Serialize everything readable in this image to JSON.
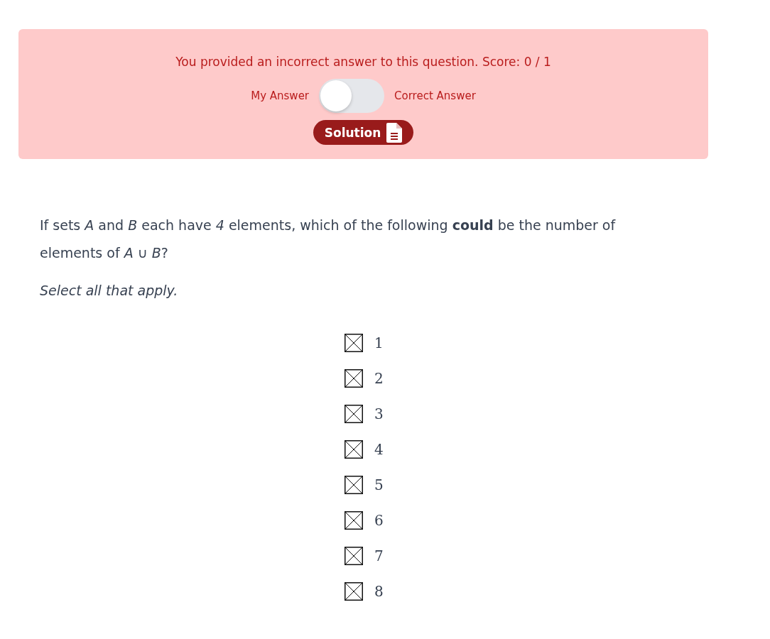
{
  "feedback": {
    "message": "You provided an incorrect answer to this question. Score: 0 / 1",
    "toggle_left": "My Answer",
    "toggle_right": "Correct Answer",
    "toggle": {
      "on": false
    },
    "solution_button": "Solution"
  },
  "question": {
    "text": "If sets *A* and *B* each have *4* elements, which of the following **could** be the number of elements of *A* ∪ *B*?",
    "instruction": "Select all that apply."
  },
  "options": [
    {
      "label": "1"
    },
    {
      "label": "2"
    },
    {
      "label": "3"
    },
    {
      "label": "4"
    },
    {
      "label": "5"
    },
    {
      "label": "6"
    },
    {
      "label": "7"
    },
    {
      "label": "8"
    }
  ]
}
